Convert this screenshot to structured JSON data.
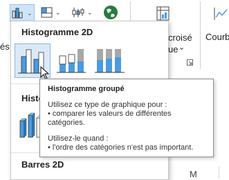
{
  "ribbon": {
    "chart_groups": [
      {
        "name": "column-chart",
        "active": true
      },
      {
        "name": "hierarchy-chart",
        "active": false
      },
      {
        "name": "statistic-chart",
        "active": false
      },
      {
        "name": "map-chart",
        "active": false
      }
    ],
    "left_edge_label": "és",
    "right_label_1": "croisé",
    "right_label_2": "ue",
    "right_label_chevron": "⌄",
    "sparkline_label": "Courb"
  },
  "dropdown": {
    "section_2d": "Histogramme 2D",
    "section_3d_partial": "Histo",
    "section_bars_2d": "Barres 2D",
    "options_2d": [
      {
        "name": "clustered-column",
        "selected": true
      },
      {
        "name": "stacked-column",
        "selected": false
      },
      {
        "name": "100-stacked-column",
        "selected": false
      }
    ]
  },
  "tooltip": {
    "title": "Histogramme groupé",
    "line1": "Utilisez ce type de graphique pour :",
    "line2": "• comparer les valeurs de différentes",
    "line3": "catégories.",
    "line4": "Utilisez-le quand :",
    "line5": "• l'ordre des catégories n'est pas important."
  },
  "sheet": {
    "column_header": "M"
  },
  "colors": {
    "accent_blue": "#4a9be0",
    "gray_bar": "#a8a8a8",
    "selected_bg": "#dbe9f7"
  }
}
